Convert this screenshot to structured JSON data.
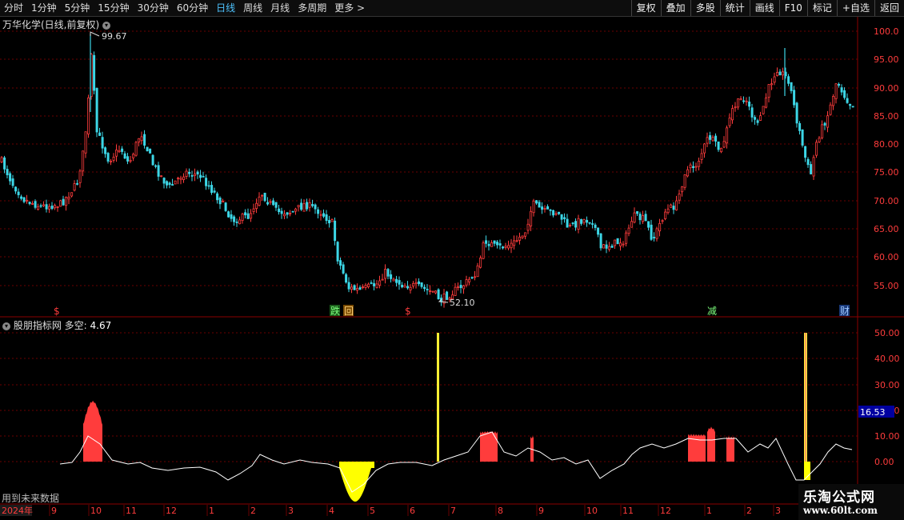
{
  "toolbar": {
    "timeframes": [
      "分时",
      "1分钟",
      "5分钟",
      "15分钟",
      "30分钟",
      "60分钟",
      "日线",
      "周线",
      "月线",
      "多周期",
      "更多 >"
    ],
    "active": "日线",
    "tools": [
      "复权",
      "叠加",
      "多股",
      "统计",
      "画线",
      "F10",
      "标记",
      "+自选",
      "返回"
    ]
  },
  "main": {
    "title": "万华化学(日线,前复权)",
    "high_label": "99.67",
    "low_label": "52.10",
    "price_axis": [
      "100.0",
      "95.00",
      "90.00",
      "85.00",
      "80.00",
      "75.00",
      "70.00",
      "65.00",
      "60.00",
      "55.00"
    ],
    "markers": [
      "$",
      "跌",
      "回",
      "$",
      "减",
      "财"
    ]
  },
  "indicator": {
    "name": "股朋指标网",
    "label": "多空:",
    "value": "4.67",
    "axis": [
      "50.00",
      "40.00",
      "30.00",
      "20.00",
      "10.00",
      "0.00"
    ],
    "current": "16.53"
  },
  "timeline": {
    "year": "2024年",
    "months": [
      "9",
      "10",
      "11",
      "12",
      "1",
      "2",
      "3",
      "4",
      "5",
      "6",
      "7",
      "8",
      "9",
      "10",
      "11",
      "12",
      "1",
      "2",
      "3"
    ]
  },
  "footer": {
    "future_note": "用到未来数据",
    "brand": "乐淘公式网",
    "url": "www.60lt.com"
  },
  "colors": {
    "up": "#ff3c3c",
    "down": "#3cd6e6",
    "line": "#ffffff",
    "yellow": "#ffff00",
    "grid": "#8b0000"
  }
}
